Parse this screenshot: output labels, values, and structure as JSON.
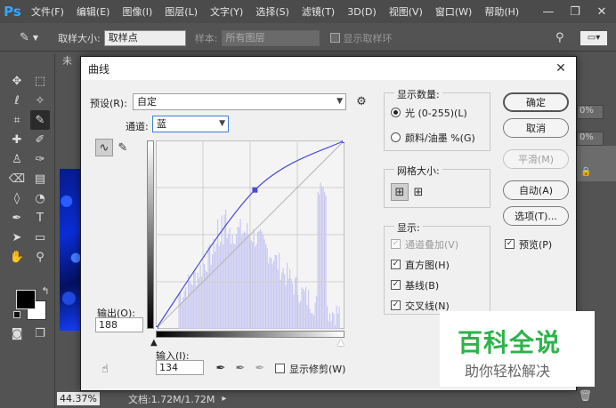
{
  "app": {
    "logo": "Ps",
    "menu": [
      "文件(F)",
      "编辑(E)",
      "图像(I)",
      "图层(L)",
      "文字(Y)",
      "选择(S)",
      "滤镜(T)",
      "3D(D)",
      "视图(V)",
      "窗口(W)",
      "帮助(H)"
    ],
    "window_controls": [
      "—",
      "❐",
      "✕"
    ]
  },
  "options_bar": {
    "sample_size_label": "取样大小:",
    "sample_size_value": "取样点",
    "sample_label": "样本:",
    "sample_value": "所有图层",
    "show_ring_label": "显示取样环"
  },
  "document": {
    "tab_label": "未",
    "zoom": "44.37%",
    "doc_info": "文档:1.72M/1.72M"
  },
  "right_panel": {
    "opacity_a": "0%",
    "opacity_b": "0%"
  },
  "dialog": {
    "title": "曲线",
    "preset_label": "预设(R):",
    "preset_value": "自定",
    "channel_label": "通道:",
    "channel_value": "蓝",
    "output_label": "输出(O):",
    "output_value": "188",
    "input_label": "输入(I):",
    "input_value": "134",
    "show_clipping_label": "显示修剪(W)",
    "display_amount": {
      "title": "显示数量:",
      "option_light": "光 (0-255)(L)",
      "option_pigment": "颜料/油墨 %(G)"
    },
    "grid_size": {
      "title": "网格大小:"
    },
    "show": {
      "title": "显示:",
      "channel_overlay": "通道叠加(V)",
      "histogram": "直方图(H)",
      "baseline": "基线(B)",
      "intersection": "交叉线(N)"
    },
    "buttons": {
      "ok": "确定",
      "cancel": "取消",
      "smooth": "平滑(M)",
      "auto": "自动(A)",
      "options": "选项(T)..."
    },
    "preview_label": "预览(P)",
    "curve": {
      "points": [
        [
          0,
          0
        ],
        [
          134,
          188
        ],
        [
          255,
          255
        ]
      ],
      "color": "#4b4bd6",
      "histogram_color": "#c9c9f2"
    }
  },
  "watermark": {
    "title": "百科全说",
    "subtitle": "助你轻松解决"
  }
}
